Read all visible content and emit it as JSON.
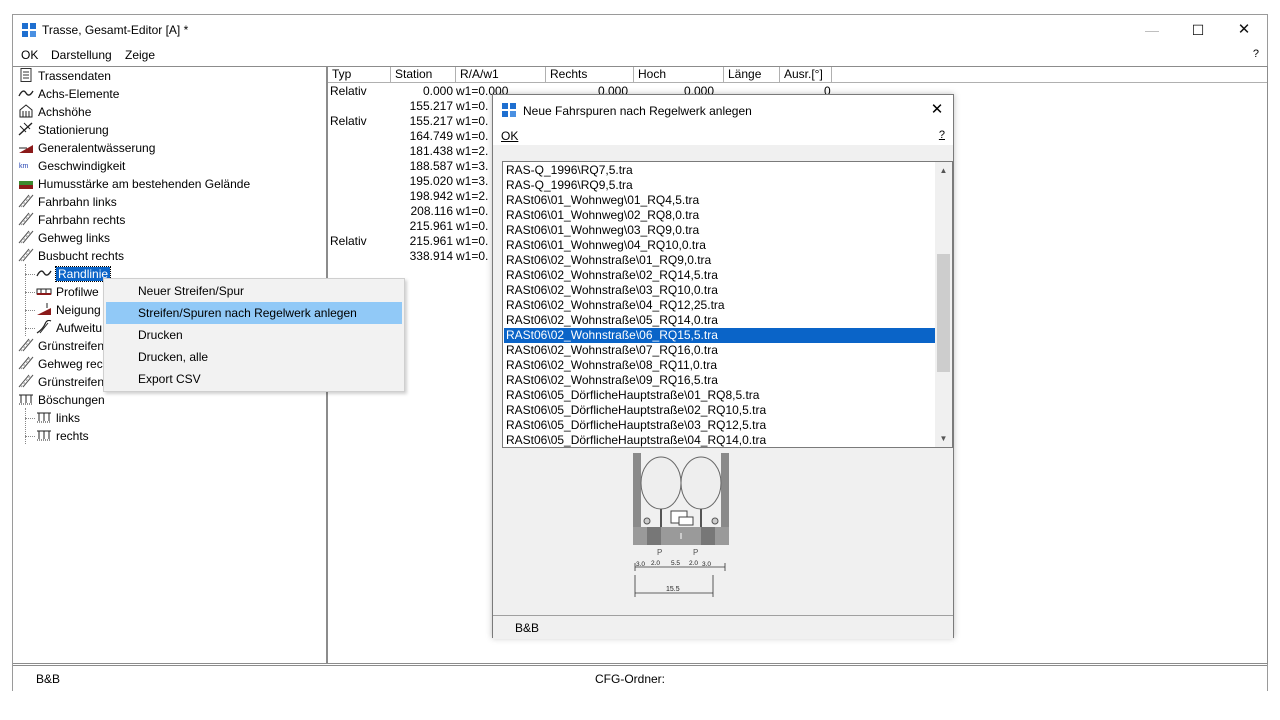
{
  "window": {
    "title": "Trasse, Gesamt-Editor  [A] *",
    "min_glyph": "—",
    "max_glyph": "☐",
    "close_glyph": "✕"
  },
  "menu": {
    "ok": "OK",
    "darstellung": "Darstellung",
    "zeige": "Zeige",
    "help": "?"
  },
  "tree": {
    "items": [
      {
        "label": "Trassendaten",
        "icon": "document-icon"
      },
      {
        "label": "Achs-Elemente",
        "icon": "curve-icon"
      },
      {
        "label": "Achshöhe",
        "icon": "building-icon"
      },
      {
        "label": "Stationierung",
        "icon": "station-icon"
      },
      {
        "label": "Generalentwässerung",
        "icon": "drainage-icon"
      },
      {
        "label": "Geschwindigkeit",
        "icon": "speed-icon"
      },
      {
        "label": "Humusstärke am bestehenden Gelände",
        "icon": "terrain-icon"
      },
      {
        "label": "Fahrbahn links",
        "icon": "lane-icon"
      },
      {
        "label": "Fahrbahn rechts",
        "icon": "lane-icon"
      },
      {
        "label": "Gehweg links",
        "icon": "lane-icon"
      },
      {
        "label": "Busbucht rechts",
        "icon": "lane-icon"
      },
      {
        "label": "Randlinie",
        "icon": "curve-icon"
      },
      {
        "label": "Profilwe",
        "icon": "profile-icon"
      },
      {
        "label": "Neigung",
        "icon": "slope-icon"
      },
      {
        "label": "Aufweitu",
        "icon": "widen-icon"
      },
      {
        "label": "Grünstreifen",
        "icon": "lane-icon"
      },
      {
        "label": "Gehweg rec",
        "icon": "lane-icon"
      },
      {
        "label": "Grünstreifen",
        "icon": "lane-icon"
      },
      {
        "label": "Böschungen",
        "icon": "embankment-icon"
      },
      {
        "label": "links",
        "icon": "embankment-icon"
      },
      {
        "label": "rechts",
        "icon": "embankment-icon"
      }
    ]
  },
  "grid": {
    "columns": [
      "Typ",
      "Station",
      "R/A/w1",
      "Rechts",
      "Hoch",
      "Länge",
      "Ausr.[°]"
    ],
    "rows": [
      {
        "typ": "Relativ",
        "station": "0.000",
        "raw": "w1=0.000",
        "rechts": "0.000",
        "hoch": "0.000",
        "laenge": "",
        "ausr": "0"
      },
      {
        "typ": "",
        "station": "155.217",
        "raw": "w1=0.",
        "rechts": "",
        "hoch": "",
        "laenge": "",
        "ausr": ""
      },
      {
        "typ": "Relativ",
        "station": "155.217",
        "raw": "w1=0.",
        "rechts": "",
        "hoch": "",
        "laenge": "",
        "ausr": ""
      },
      {
        "typ": "",
        "station": "164.749",
        "raw": "w1=0.",
        "rechts": "",
        "hoch": "",
        "laenge": "",
        "ausr": ""
      },
      {
        "typ": "",
        "station": "181.438",
        "raw": "w1=2.",
        "rechts": "",
        "hoch": "",
        "laenge": "",
        "ausr": ""
      },
      {
        "typ": "",
        "station": "188.587",
        "raw": "w1=3.",
        "rechts": "",
        "hoch": "",
        "laenge": "",
        "ausr": ""
      },
      {
        "typ": "",
        "station": "195.020",
        "raw": "w1=3.",
        "rechts": "",
        "hoch": "",
        "laenge": "",
        "ausr": ""
      },
      {
        "typ": "",
        "station": "198.942",
        "raw": "w1=2.",
        "rechts": "",
        "hoch": "",
        "laenge": "",
        "ausr": ""
      },
      {
        "typ": "",
        "station": "208.116",
        "raw": "w1=0.",
        "rechts": "",
        "hoch": "",
        "laenge": "",
        "ausr": ""
      },
      {
        "typ": "",
        "station": "215.961",
        "raw": "w1=0.",
        "rechts": "",
        "hoch": "",
        "laenge": "",
        "ausr": ""
      },
      {
        "typ": "Relativ",
        "station": "215.961",
        "raw": "w1=0.",
        "rechts": "",
        "hoch": "",
        "laenge": "",
        "ausr": ""
      },
      {
        "typ": "",
        "station": "338.914",
        "raw": "w1=0.",
        "rechts": "",
        "hoch": "",
        "laenge": "",
        "ausr": ""
      }
    ]
  },
  "context_menu": {
    "items": [
      "Neuer Streifen/Spur",
      "Streifen/Spuren nach Regelwerk anlegen",
      "Drucken",
      "Drucken, alle",
      "Export CSV"
    ],
    "highlighted_index": 1
  },
  "dialog": {
    "title": "Neue Fahrspuren nach Regelwerk anlegen",
    "ok": "OK",
    "help": "?",
    "close_glyph": "✕",
    "status": "B&B",
    "list_items": [
      "RAS-Q_1996\\RQ7,5.tra",
      "RAS-Q_1996\\RQ9,5.tra",
      "RASt06\\01_Wohnweg\\01_RQ4,5.tra",
      "RASt06\\01_Wohnweg\\02_RQ8,0.tra",
      "RASt06\\01_Wohnweg\\03_RQ9,0.tra",
      "RASt06\\01_Wohnweg\\04_RQ10,0.tra",
      "RASt06\\02_Wohnstraße\\01_RQ9,0.tra",
      "RASt06\\02_Wohnstraße\\02_RQ14,5.tra",
      "RASt06\\02_Wohnstraße\\03_RQ10,0.tra",
      "RASt06\\02_Wohnstraße\\04_RQ12,25.tra",
      "RASt06\\02_Wohnstraße\\05_RQ14,0.tra",
      "RASt06\\02_Wohnstraße\\06_RQ15,5.tra",
      "RASt06\\02_Wohnstraße\\07_RQ16,0.tra",
      "RASt06\\02_Wohnstraße\\08_RQ11,0.tra",
      "RASt06\\02_Wohnstraße\\09_RQ16,5.tra",
      "RASt06\\05_DörflicheHauptstraße\\01_RQ8,5.tra",
      "RASt06\\05_DörflicheHauptstraße\\02_RQ10,5.tra",
      "RASt06\\05_DörflicheHauptstraße\\03_RQ12,5.tra",
      "RASt06\\05_DörflicheHauptstraße\\04_RQ14,0.tra"
    ],
    "selected_index": 11,
    "preview": {
      "parking_labels": [
        "P",
        "P"
      ],
      "dims": [
        "3.0",
        "2.0",
        "5.5",
        "2.0",
        "3.0"
      ],
      "total": "15.5"
    }
  },
  "status": {
    "left": "B&B",
    "cfg": "CFG-Ordner:"
  },
  "colors": {
    "selection": "#0a64c8",
    "menu_highlight": "#91c9f7",
    "accent_icon": "#1f6fd0"
  }
}
